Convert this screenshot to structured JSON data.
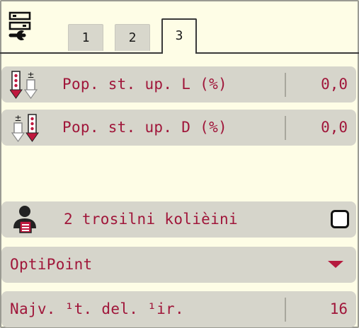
{
  "tabs": [
    {
      "label": "1",
      "active": false
    },
    {
      "label": "2",
      "active": false
    },
    {
      "label": "3",
      "active": true
    }
  ],
  "rows": {
    "left_limit": {
      "label": "Pop. st. up. L (%)",
      "value": "0,0",
      "icon": "spread-rate-left-icon"
    },
    "right_limit": {
      "label": "Pop. st. up. D (%)",
      "value": "0,0",
      "icon": "spread-rate-right-icon"
    },
    "ropes": {
      "label": "2 trosilni kolièini",
      "checked": false,
      "icon": "operator-icon"
    },
    "optipoint": {
      "label": "OptiPoint",
      "icon": "dropdown-caret-icon"
    },
    "max_parts": {
      "label": "Najv. ¹t. del. ¹ir.",
      "value": "16"
    }
  },
  "colors": {
    "background": "#fefde6",
    "row": "#d6d5cb",
    "text": "#a0163a",
    "accent_red": "#b51a3e"
  }
}
